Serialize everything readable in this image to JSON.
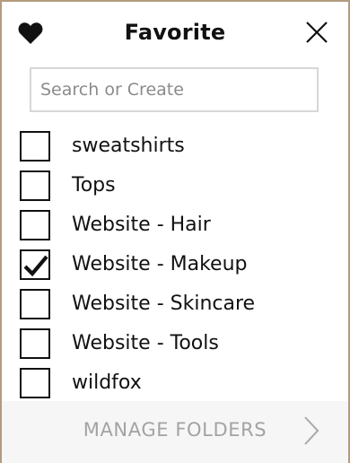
{
  "header": {
    "title": "Favorite",
    "heart_icon": "heart-icon",
    "close_icon": "close-icon"
  },
  "search": {
    "placeholder": "Search or Create",
    "value": ""
  },
  "folders": [
    {
      "label": "sweatshirts",
      "checked": false
    },
    {
      "label": "Tops",
      "checked": false
    },
    {
      "label": "Website - Hair",
      "checked": false
    },
    {
      "label": "Website - Makeup",
      "checked": true
    },
    {
      "label": "Website - Skincare",
      "checked": false
    },
    {
      "label": "Website - Tools",
      "checked": false
    },
    {
      "label": "wildfox",
      "checked": false
    }
  ],
  "footer": {
    "label": "MANAGE FOLDERS",
    "chevron_icon": "chevron-right-icon"
  },
  "colors": {
    "accent_border": "#b39b7e",
    "footer_bg": "#f6f6f6",
    "footer_text": "#a3a3a3",
    "search_border": "#d7d7d7"
  }
}
